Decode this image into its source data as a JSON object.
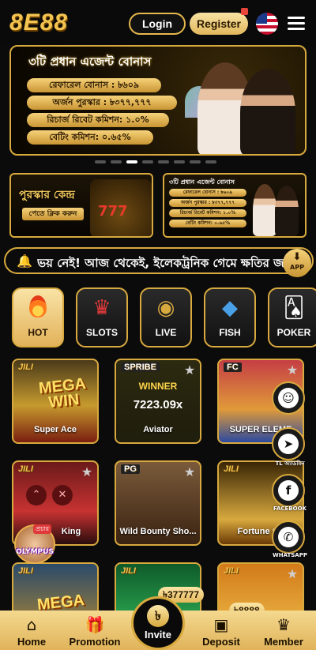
{
  "header": {
    "logo": "8E88",
    "login_label": "Login",
    "register_label": "Register",
    "language_icon": "us-flag-icon",
    "menu_icon": "hamburger-menu-icon"
  },
  "banner": {
    "title": "৩টি প্রধান এজেন্ট বোনাস",
    "rows": [
      "রেফারেল বোনাস : ৳৬০৯",
      "অর্জন পুরস্কার : ৳৩৭৭,৭৭৭",
      "রিচার্জ রিবেট কমিশন: ১.০%",
      "বেটিং কমিশন: ০.৬৫%"
    ],
    "active_slide": 3,
    "slide_count": 9
  },
  "promos": {
    "reward_center_title": "পুরস্কার কেন্দ্র",
    "reward_center_sub": "পেতে ক্লিক করুন",
    "agent_title": "৩টি প্রধান এজেন্ট বোনাস",
    "agent_rows": [
      "রেফারেল বোনাস : ৳৬০৯",
      "অর্জন পুরস্কার : ৳৩৭৭,৭৭৭",
      "রিচার্জ রিবেট কমিশন: ১.০%",
      "বেটিং কমিশন: ০.৬৫%"
    ]
  },
  "marquee": {
    "text": "ভয় নেই! আজ থেকেই, ইলেকট্রনিক গেমে ক্ষতির জন্য",
    "app_label": "APP"
  },
  "categories": [
    {
      "label": "HOT",
      "icon": "fire-icon",
      "active": true
    },
    {
      "label": "SLOTS",
      "icon": "jester-hat-icon",
      "active": false
    },
    {
      "label": "LIVE",
      "icon": "casino-chip-icon",
      "active": false
    },
    {
      "label": "FISH",
      "icon": "fish-icon",
      "active": false
    },
    {
      "label": "POKER",
      "icon": "playing-cards-icon",
      "active": false
    }
  ],
  "games": [
    {
      "name": "Super Ace",
      "brand": "JILI",
      "art": "MEGA WIN"
    },
    {
      "name": "Aviator",
      "brand": "SPRIBE",
      "art": "WINNER",
      "multiplier": "7223.09x"
    },
    {
      "name": "SUPER ELEME",
      "brand": "FC"
    },
    {
      "name": "King",
      "brand": "JILI"
    },
    {
      "name": "Wild Bounty Sho...",
      "brand": "PG"
    },
    {
      "name": "Fortune Ge",
      "brand": "JILI"
    },
    {
      "name": "",
      "brand": "JILI",
      "art": "MEGA"
    },
    {
      "name": "",
      "brand": "JILI"
    },
    {
      "name": "",
      "brand": "JILI"
    }
  ],
  "social": [
    {
      "caption": "",
      "icon": "chat-support-icon"
    },
    {
      "caption": "TL অ্যাডমিন",
      "icon": "telegram-icon"
    },
    {
      "caption": "FACEBOOK",
      "icon": "facebook-icon"
    },
    {
      "caption": "WHATSAPP",
      "icon": "whatsapp-icon"
    }
  ],
  "floating": {
    "olympus_label": "OLYMPUS",
    "olympus_tag": "প্রচার",
    "jackpot_1": "৳377777",
    "jackpot_2": "৳8888"
  },
  "nav": {
    "home": "Home",
    "promotion": "Promotion",
    "invite": "Invite",
    "deposit": "Deposit",
    "member": "Member"
  }
}
